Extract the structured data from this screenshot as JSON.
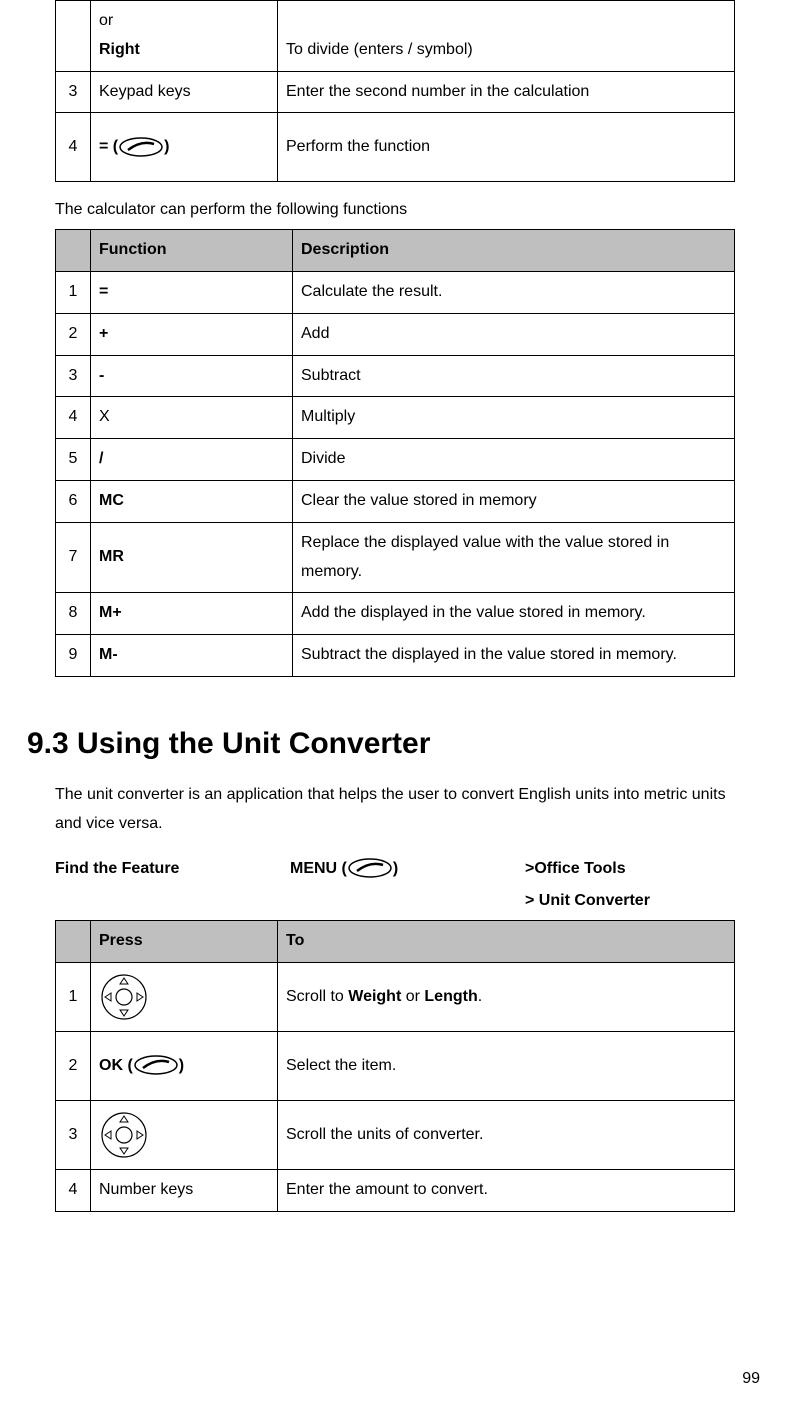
{
  "table1": {
    "rows": [
      {
        "num": "",
        "press_pre": "or ",
        "press_bold": "Right",
        "to": "To divide (enters / symbol)"
      },
      {
        "num": "3",
        "press": "Keypad keys",
        "to": "Enter the second number in the calculation"
      },
      {
        "num": "4",
        "press_pre": "= (",
        "press_post": ")",
        "icon": "softkey",
        "to": "Perform the function"
      }
    ]
  },
  "intro1": "The calculator can perform the following functions",
  "table2": {
    "headers": [
      "",
      "Function",
      "Description"
    ],
    "rows": [
      {
        "num": "1",
        "func": "=",
        "func_bold": true,
        "desc": "Calculate the result."
      },
      {
        "num": "2",
        "func": "+",
        "func_bold": true,
        "desc": "Add"
      },
      {
        "num": "3",
        "func": "-",
        "func_bold": true,
        "desc": "Subtract"
      },
      {
        "num": "4",
        "func": "X",
        "func_bold": false,
        "desc": "Multiply"
      },
      {
        "num": "5",
        "func": "/",
        "func_bold": true,
        "desc": "Divide"
      },
      {
        "num": "6",
        "func": "MC",
        "func_bold": true,
        "desc": "Clear the value stored in memory"
      },
      {
        "num": "7",
        "func": "MR",
        "func_bold": true,
        "desc": "Replace the displayed value with the value stored in memory."
      },
      {
        "num": "8",
        "func": "M+",
        "func_bold": true,
        "desc": "Add the displayed in the value stored in memory."
      },
      {
        "num": "9",
        "func": "M-",
        "func_bold": true,
        "desc": "Subtract the displayed in the value stored in memory."
      }
    ]
  },
  "heading": "9.3  Using the Unit  Converter",
  "para": "The unit converter is an application that helps the user to convert English units into metric units and vice versa.",
  "find": {
    "label": "Find the Feature",
    "menu_pre": "MENU (",
    "menu_post": ")",
    "path1": ">Office Tools",
    "path2": "> Unit Converter"
  },
  "table3": {
    "headers": [
      "",
      "Press",
      "To"
    ],
    "rows": [
      {
        "num": "1",
        "icon": "nav",
        "to_pre": "Scroll to ",
        "to_b1": "Weight",
        "to_mid": " or ",
        "to_b2": "Length",
        "to_post": "."
      },
      {
        "num": "2",
        "press_pre": "OK (",
        "press_post": ")",
        "icon": "softkey",
        "to": "Select the item."
      },
      {
        "num": "3",
        "icon": "nav",
        "to": "Scroll the units of converter."
      },
      {
        "num": "4",
        "press": "Number keys",
        "to": "Enter the amount to convert."
      }
    ]
  },
  "page": "99"
}
